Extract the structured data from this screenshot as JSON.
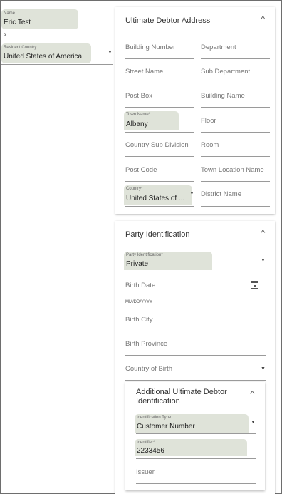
{
  "left_panel": {
    "name": {
      "label": "Name",
      "value": "Eric Test"
    },
    "small_text": "9",
    "resident_country": {
      "label": "Resident Country",
      "value": "United States of America"
    }
  },
  "ultimate_debtor_address": {
    "title": "Ultimate Debtor Address",
    "fields": {
      "building_number": "Building Number",
      "department": "Department",
      "street_name": "Street Name",
      "sub_department": "Sub Department",
      "post_box": "Post Box",
      "building_name": "Building Name",
      "town_name_label": "Town Name*",
      "town_name_value": "Albany",
      "floor": "Floor",
      "country_sub_division": "Country Sub Division",
      "room": "Room",
      "post_code": "Post Code",
      "town_location_name": "Town Location Name",
      "country_label": "Country*",
      "country_value": "United States of ...",
      "district_name": "District Name"
    }
  },
  "party_identification": {
    "title": "Party Identification",
    "party_id_label": "Party Identification*",
    "party_id_value": "Private",
    "birth_date": "Birth Date",
    "birth_date_hint": "MM/DD/YYYY",
    "birth_city": "Birth City",
    "birth_province": "Birth Province",
    "country_of_birth": "Country of Birth"
  },
  "additional_identification": {
    "title_line1": "Additional Ultimate Debtor",
    "title_line2": "Identification",
    "identification_type_label": "Identification Type",
    "identification_type_value": "Customer Number",
    "identifier_label": "Identifier*",
    "identifier_value": "2233456",
    "issuer": "Issuer"
  },
  "icons": {
    "collapse": "chevron-up-icon",
    "dropdown": "caret-down-icon",
    "calendar": "calendar-icon"
  }
}
